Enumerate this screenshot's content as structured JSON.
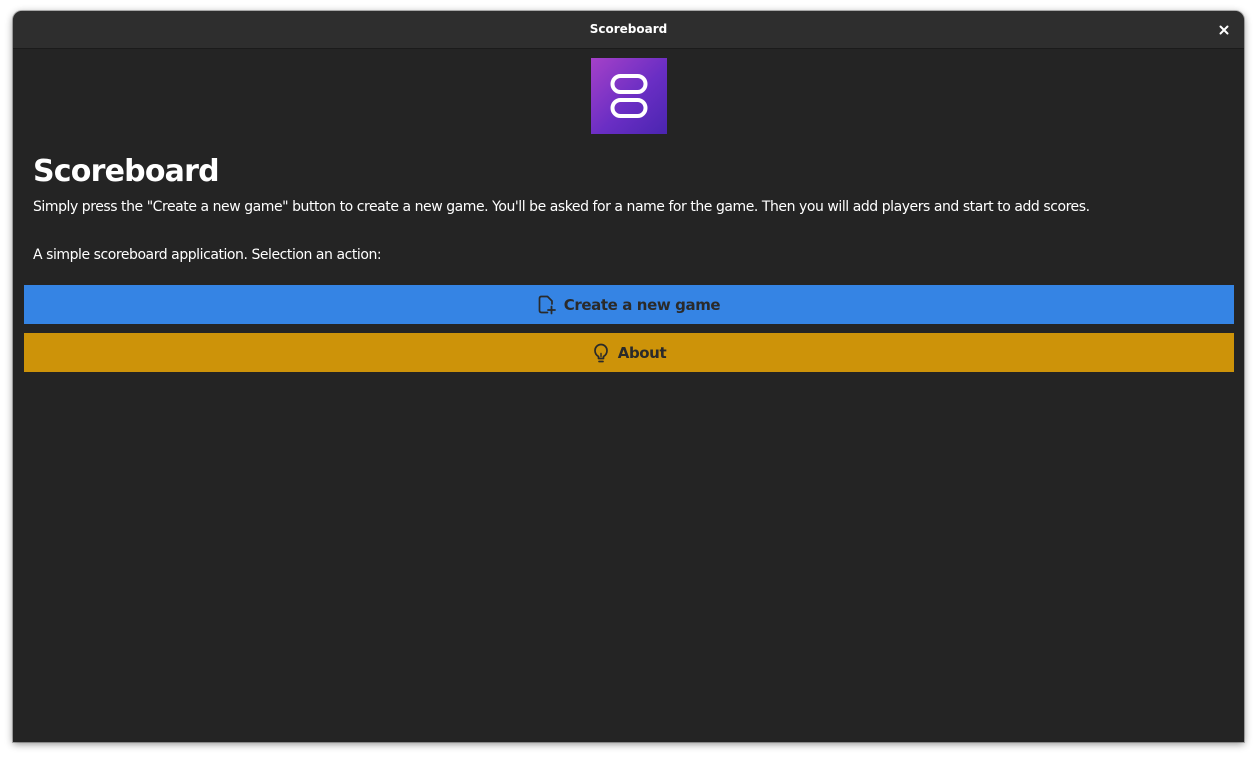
{
  "window": {
    "title": "Scoreboard",
    "close_icon": "close-icon"
  },
  "app": {
    "icon": "scoreboard-app-icon",
    "title": "Scoreboard",
    "description": "Simply press the \"Create a new game\" button to create a new game. You'll be asked for a name for the game. Then you will add players and start to add scores.",
    "prompt": "A simple scoreboard application. Selection an action:"
  },
  "actions": {
    "create": {
      "label": "Create a new game",
      "icon": "document-new-icon",
      "color": "#3584e4"
    },
    "about": {
      "label": "About",
      "icon": "lightbulb-icon",
      "color": "#cd9309"
    }
  }
}
